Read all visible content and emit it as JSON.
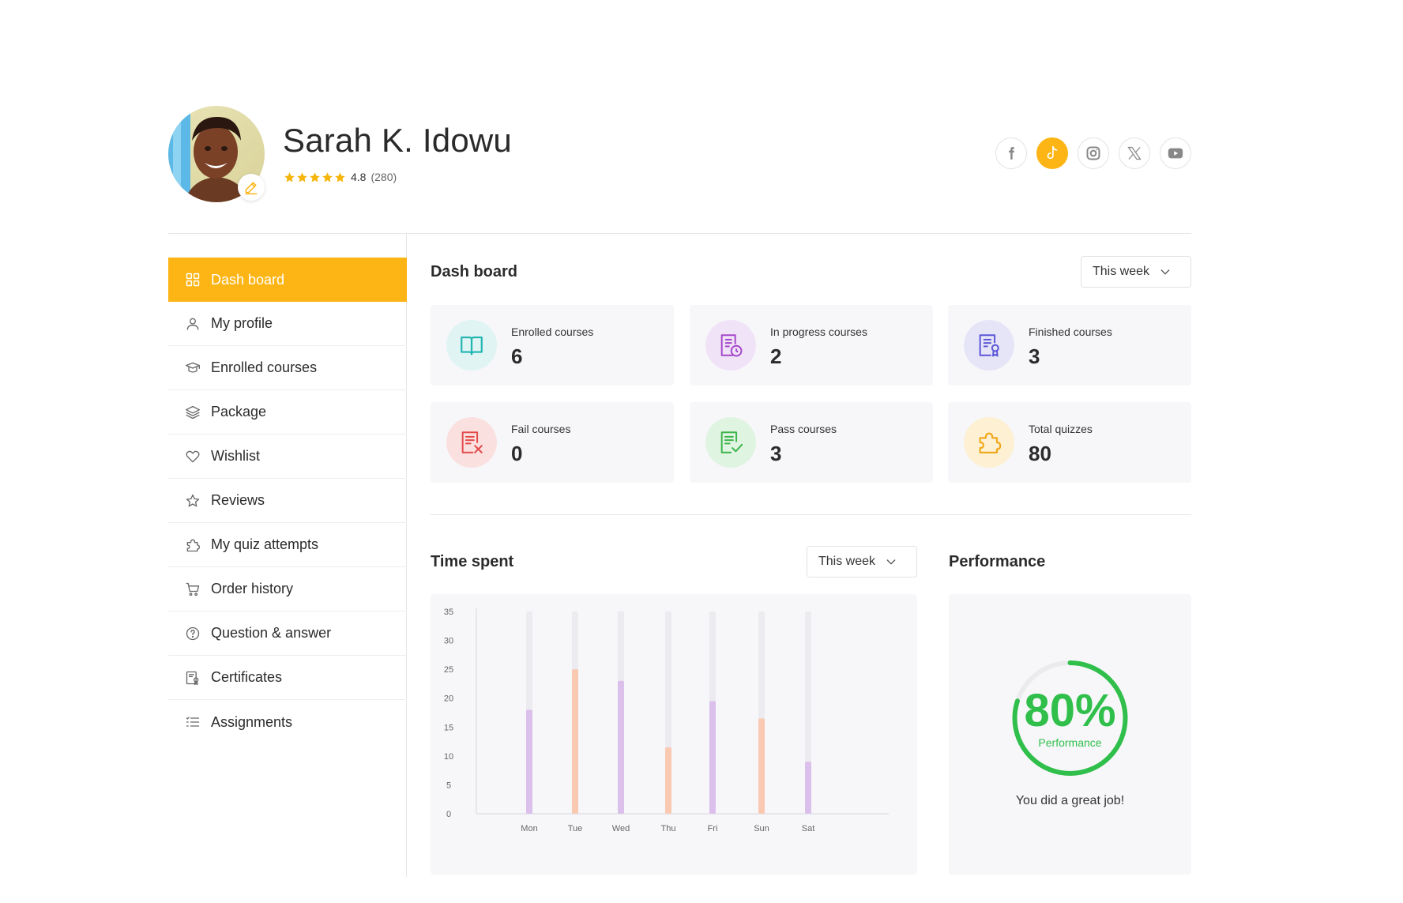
{
  "profile": {
    "name": "Sarah K. Idowu",
    "rating": "4.8",
    "rating_count": "(280)",
    "stars": 5
  },
  "socials": [
    {
      "icon": "facebook-icon",
      "active": false
    },
    {
      "icon": "tiktok-icon",
      "active": true
    },
    {
      "icon": "instagram-icon",
      "active": false
    },
    {
      "icon": "x-icon",
      "active": false
    },
    {
      "icon": "youtube-icon",
      "active": false
    }
  ],
  "sidebar": {
    "items": [
      {
        "label": "Dash board",
        "icon": "grid-icon",
        "active": true
      },
      {
        "label": "My profile",
        "icon": "user-icon",
        "active": false
      },
      {
        "label": "Enrolled courses",
        "icon": "graduation-cap-icon",
        "active": false
      },
      {
        "label": "Package",
        "icon": "layers-icon",
        "active": false
      },
      {
        "label": "Wishlist",
        "icon": "heart-icon",
        "active": false
      },
      {
        "label": "Reviews",
        "icon": "star-icon",
        "active": false
      },
      {
        "label": "My quiz attempts",
        "icon": "puzzle-icon",
        "active": false
      },
      {
        "label": "Order history",
        "icon": "cart-icon",
        "active": false
      },
      {
        "label": "Question & answer",
        "icon": "question-icon",
        "active": false
      },
      {
        "label": "Certificates",
        "icon": "certificate-icon",
        "active": false
      },
      {
        "label": "Assignments",
        "icon": "list-icon",
        "active": false
      }
    ]
  },
  "dashboard": {
    "title": "Dash board",
    "period": "This week",
    "stats": [
      {
        "label": "Enrolled courses",
        "value": "6",
        "icon": "open-book-icon",
        "color": "#1fb5b0",
        "bg": "#dff4f3"
      },
      {
        "label": "In progress courses",
        "value": "2",
        "icon": "document-clock-icon",
        "color": "#a347c9",
        "bg": "#f1e3f7"
      },
      {
        "label": "Finished courses",
        "value": "3",
        "icon": "document-award-icon",
        "color": "#5b56d6",
        "bg": "#e6e5f8"
      },
      {
        "label": "Fail courses",
        "value": "0",
        "icon": "document-x-icon",
        "color": "#e34a4a",
        "bg": "#fbe0e0"
      },
      {
        "label": "Pass courses",
        "value": "3",
        "icon": "document-check-icon",
        "color": "#3cb44b",
        "bg": "#e0f4e2"
      },
      {
        "label": "Total quizzes",
        "value": "80",
        "icon": "puzzle-icon",
        "color": "#f0a81a",
        "bg": "#fdf0d3"
      }
    ]
  },
  "time_spent": {
    "title": "Time spent",
    "period": "This week"
  },
  "performance": {
    "title": "Performance",
    "value_text": "80%",
    "value": 80,
    "label": "Performance",
    "message": "You did a great job!",
    "color": "#2fbf4a"
  },
  "chart_data": {
    "type": "bar",
    "categories": [
      "Mon",
      "Tue",
      "Wed",
      "Thu",
      "Fri",
      "Sun",
      "Sat"
    ],
    "values": [
      18,
      25,
      23,
      11.5,
      19.5,
      16.5,
      9
    ],
    "bar_colors": [
      "#dcc0ec",
      "#f9c9b2",
      "#dcc0ec",
      "#f9c9b2",
      "#dcc0ec",
      "#f9c9b2",
      "#dcc0ec"
    ],
    "track_color": "#ececf0",
    "ylim": [
      0,
      35
    ],
    "yticks": [
      0,
      5,
      10,
      15,
      20,
      25,
      30,
      35
    ],
    "xlabel": "",
    "ylabel": ""
  }
}
